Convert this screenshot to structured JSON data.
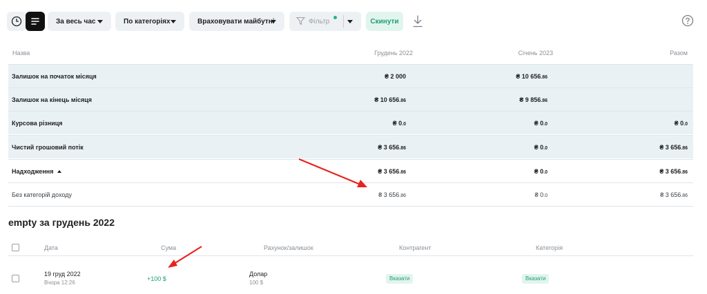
{
  "toolbar": {
    "period": "За весь час",
    "grouping": "По категоріях",
    "future": "Враховувати майбутні",
    "filter": "Фільтр",
    "reset": "Скинути"
  },
  "table": {
    "headers": [
      "Назва",
      "Грудень 2022",
      "Січень 2023",
      "Разом"
    ],
    "rows": [
      {
        "label": "Залишок на початок місяця",
        "c1": "₴ 2 000",
        "c1s": "",
        "c2": "₴ 10 656",
        "c2s": ".86",
        "c3": "",
        "c3s": ""
      },
      {
        "label": "Залишок на кінець місяця",
        "c1": "₴ 10 656",
        "c1s": ".86",
        "c2": "₴ 9 856",
        "c2s": ".86",
        "c3": "",
        "c3s": ""
      },
      {
        "label": "Курсова різниця",
        "c1": "₴ 0",
        "c1s": ".0",
        "c2": "₴ 0",
        "c2s": ".0",
        "c3": "₴ 0",
        "c3s": ".0"
      },
      {
        "label": "Чистий грошовий потік",
        "c1": "₴ 3 656",
        "c1s": ".86",
        "c2": "₴ 0",
        "c2s": ".0",
        "c3": "₴ 3 656",
        "c3s": ".86"
      },
      {
        "label": "Надходження",
        "c1": "₴ 3 656",
        "c1s": ".86",
        "c2": "₴ 0",
        "c2s": ".0",
        "c3": "₴ 3 656",
        "c3s": ".86"
      },
      {
        "label": "Без категорій доходу",
        "c1": "₴ 3 656",
        "c1s": ".86",
        "c2": "₴ 0",
        "c2s": ".0",
        "c3": "₴ 3 656",
        "c3s": ".86"
      }
    ]
  },
  "transactions": {
    "title": "empty за грудень 2022",
    "headers": [
      "Дата",
      "Сума",
      "Рахунок/залишок",
      "Контрагент",
      "Категорія"
    ],
    "rows": [
      {
        "date": "19 груд 2022",
        "time": "Вчора 12:26",
        "amount": "+100 $",
        "account": "Долар",
        "balance": "100 $",
        "contractor": "Вказати",
        "category": "Вказати"
      }
    ]
  },
  "colors": {
    "accent": "#1e9e74",
    "row_shade": "#eaf1f5",
    "arrow": "#e8231e"
  }
}
